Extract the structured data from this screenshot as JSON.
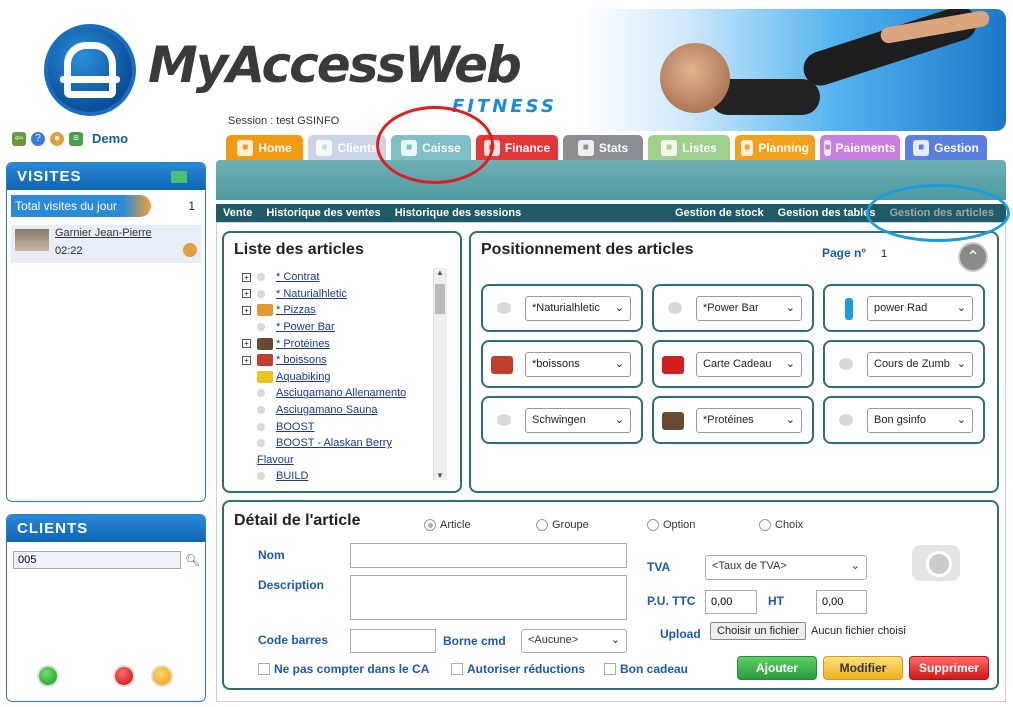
{
  "header": {
    "logo_text": "MyAccessWeb",
    "logo_sub": "FITNESS",
    "session": "Session : test GSINFO",
    "user": "Demo"
  },
  "tabs": [
    {
      "label": "Home",
      "color": "#f39a13",
      "icon": "home-icon"
    },
    {
      "label": "Clients",
      "color": "#c9d4e6",
      "icon": "user-icon"
    },
    {
      "label": "Caisse",
      "color": "#7fbfc8",
      "icon": "cash-register-icon"
    },
    {
      "label": "Finance",
      "color": "#e2383a",
      "icon": "finance-icon"
    },
    {
      "label": "Stats",
      "color": "#8b8f94",
      "icon": "stats-icon"
    },
    {
      "label": "Listes",
      "color": "#9fd08c",
      "icon": "list-icon"
    },
    {
      "label": "Planning",
      "color": "#f1a11c",
      "icon": "calendar-icon"
    },
    {
      "label": "Paiements",
      "color": "#c77fe0",
      "icon": "payment-icon"
    },
    {
      "label": "Gestion",
      "color": "#5a7fe0",
      "icon": "gear-icon"
    }
  ],
  "subnav": {
    "left": [
      "Vente",
      "Historique des ventes",
      "Historique des sessions"
    ],
    "right": [
      "Gestion de stock",
      "Gestion des tables",
      "Gestion des articles"
    ]
  },
  "visites": {
    "title": "VISITES",
    "total_label": "Total visites du jour",
    "total_count": "1",
    "visitor_name": "Garnier Jean-Pierre",
    "visitor_time": "02:22"
  },
  "clients": {
    "title": "CLIENTS",
    "search_value": "005"
  },
  "liste": {
    "title": "Liste des articles",
    "items": [
      {
        "label": "* Contrat",
        "expandable": true,
        "icon": "generic-icon"
      },
      {
        "label": "* Naturialhletic",
        "expandable": true,
        "icon": "generic-icon"
      },
      {
        "label": "* Pizzas",
        "expandable": true,
        "icon": "pizza-icon"
      },
      {
        "label": "* Power Bar",
        "expandable": false,
        "icon": "generic-icon"
      },
      {
        "label": "* Protéines",
        "expandable": true,
        "icon": "protein-icon"
      },
      {
        "label": "* boissons",
        "expandable": true,
        "icon": "bottles-icon"
      },
      {
        "label": "Aquabiking",
        "expandable": false,
        "icon": "w-logo-icon"
      },
      {
        "label": "Asciugamano Allenamento",
        "expandable": false,
        "icon": "generic-icon"
      },
      {
        "label": "Asciugamano Sauna",
        "expandable": false,
        "icon": "generic-icon"
      },
      {
        "label": "BOOST",
        "expandable": false,
        "icon": "generic-icon"
      },
      {
        "label": "BOOST - Alaskan Berry",
        "expandable": false,
        "icon": "generic-icon"
      },
      {
        "label": "Flavour",
        "expandable": false,
        "icon": "none",
        "continuation": true
      },
      {
        "label": "BUILD",
        "expandable": false,
        "icon": "generic-icon"
      }
    ]
  },
  "position": {
    "title": "Positionnement des articles",
    "page_label": "Page n°",
    "page_num": "1",
    "slots": [
      {
        "value": "*Naturialhletic",
        "icon": "generic-icon"
      },
      {
        "value": "*Power Bar",
        "icon": "generic-icon"
      },
      {
        "value": "power Rad",
        "icon": "bottle-icon"
      },
      {
        "value": "*boissons",
        "icon": "bottles-icon"
      },
      {
        "value": "Carte Cadeau",
        "icon": "gift-card-icon"
      },
      {
        "value": "Cours de Zumb",
        "icon": "generic-icon"
      },
      {
        "value": "Schwingen",
        "icon": "generic-icon"
      },
      {
        "value": "*Protéines",
        "icon": "protein-icon"
      },
      {
        "value": "Bon gsinfo",
        "icon": "generic-icon"
      }
    ]
  },
  "detail": {
    "title": "Détail de l'article",
    "radios": [
      "Article",
      "Groupe",
      "Option",
      "Choix"
    ],
    "nom_label": "Nom",
    "description_label": "Description",
    "code_barres_label": "Code barres",
    "borne_label": "Borne cmd",
    "borne_value": "<Aucune>",
    "tva_label": "TVA",
    "tva_value": "<Taux de TVA>",
    "pu_ttc_label": "P.U. TTC",
    "pu_ttc_value": "0,00",
    "ht_label": "HT",
    "ht_value": "0,00",
    "upload_label": "Upload",
    "file_button": "Choisir un fichier",
    "file_status": "Aucun fichier choisi",
    "checks": [
      "Ne pas compter dans le CA",
      "Autoriser réductions",
      "Bon cadeau"
    ],
    "buttons": {
      "add": "Ajouter",
      "edit": "Modifier",
      "delete": "Supprimer"
    }
  }
}
